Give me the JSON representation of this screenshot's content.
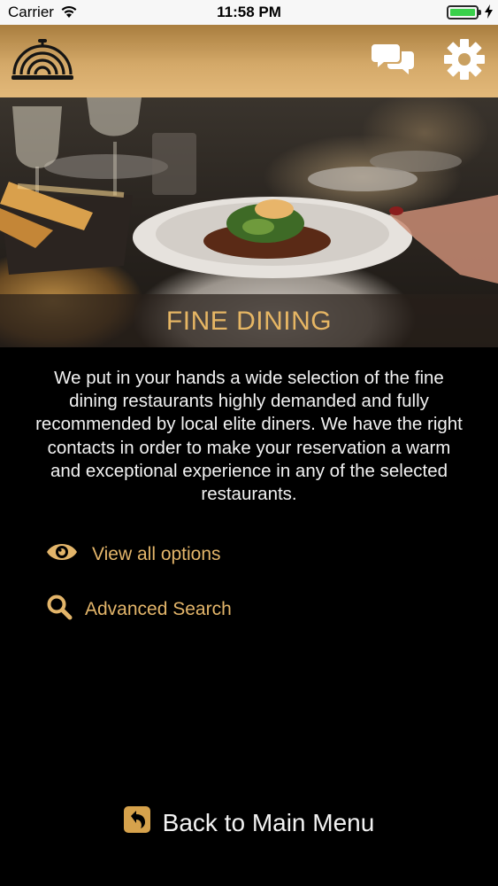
{
  "status_bar": {
    "carrier": "Carrier",
    "time": "11:58 PM",
    "battery_color": "#3ad04b"
  },
  "header": {
    "logo_icon": "cloche-icon",
    "chat_icon": "chat-bubbles-icon",
    "settings_icon": "gear-icon",
    "gradient_colors": [
      "#a97e3f",
      "#e3b97a"
    ]
  },
  "hero": {
    "title": "FINE DINING",
    "title_color": "#e6b664"
  },
  "description": "We put in your hands a wide selection of the fine dining restaurants highly demanded and fully recommended by local elite diners. We have the right contacts in order to make your reservation a warm and exceptional experience in any of the selected restaurants.",
  "options": [
    {
      "label": "View all options",
      "icon": "eye-icon"
    },
    {
      "label": "Advanced Search",
      "icon": "search-icon"
    }
  ],
  "accent_color": "#e3b56a",
  "footer": {
    "back_label": "Back to Main Menu",
    "back_icon": "back-arrow-icon"
  }
}
